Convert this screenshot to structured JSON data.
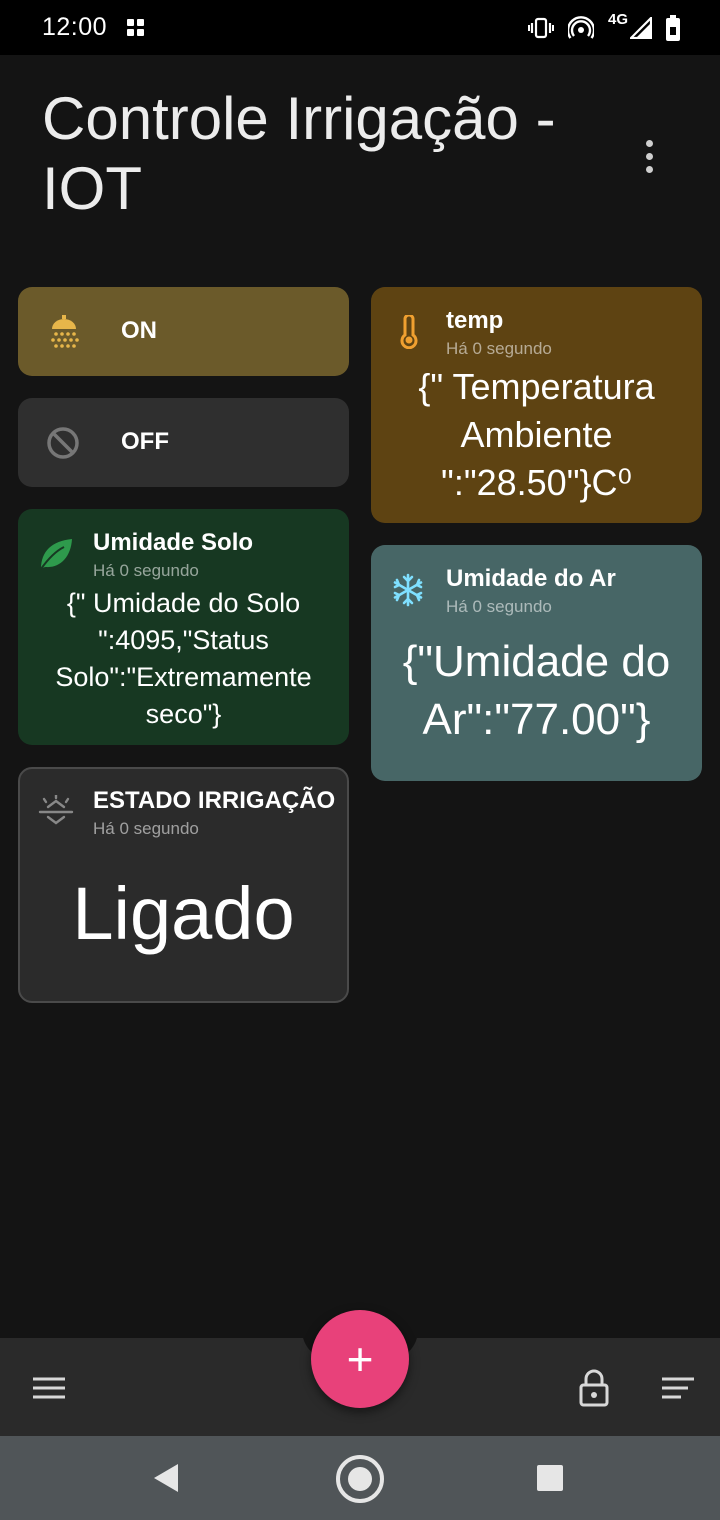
{
  "status_bar": {
    "time": "12:00",
    "network_label": "4G",
    "icons": [
      "apps-grid-icon",
      "vibrate-icon",
      "hotspot-icon",
      "signal-icon",
      "battery-icon"
    ]
  },
  "header": {
    "title": "Controle Irrigação  - IOT",
    "menu_icon": "more-vertical-icon"
  },
  "buttons": {
    "on": {
      "label": "ON",
      "icon": "shower-icon",
      "color": "#6b5a2a",
      "icon_color": "#e7b64a"
    },
    "off": {
      "label": "OFF",
      "icon": "block-icon",
      "color": "#2f2f2f"
    }
  },
  "cards": {
    "temp": {
      "title": "temp",
      "subtitle": "Há 0 segundo",
      "value": "{\" Temperatura Ambiente \":\"28.50\"}C⁰",
      "icon": "thermometer-icon",
      "color": "#5e4312",
      "icon_color": "#f0a030"
    },
    "soil": {
      "title": "Umidade Solo",
      "subtitle": "Há 0 segundo",
      "value": "{\" Umidade do Solo \":4095,\"Status Solo\":\"Extremamente seco\"}",
      "icon": "leaf-icon",
      "color": "#173822",
      "icon_color": "#2e9a4c"
    },
    "air": {
      "title": "Umidade do Ar",
      "subtitle": "Há 0 segundo",
      "value": "{\"Umidade do Ar\":\"77.00\"}",
      "icon": "snowflake-icon",
      "color": "#476666",
      "icon_color": "#7fe0ff"
    },
    "state": {
      "title": "ESTADO IRRIGAÇÃO",
      "subtitle": "Há 0 segundo",
      "value": "Ligado",
      "icon": "sprinkler-icon",
      "color": "#2b2b2b"
    }
  },
  "bottom_bar": {
    "fab_label": "+",
    "fab_color": "#e8417a",
    "icons": [
      "menu-icon",
      "lock-icon",
      "sort-icon"
    ]
  },
  "nav_bar": {
    "icons": [
      "back-icon",
      "home-icon",
      "recents-icon"
    ]
  }
}
